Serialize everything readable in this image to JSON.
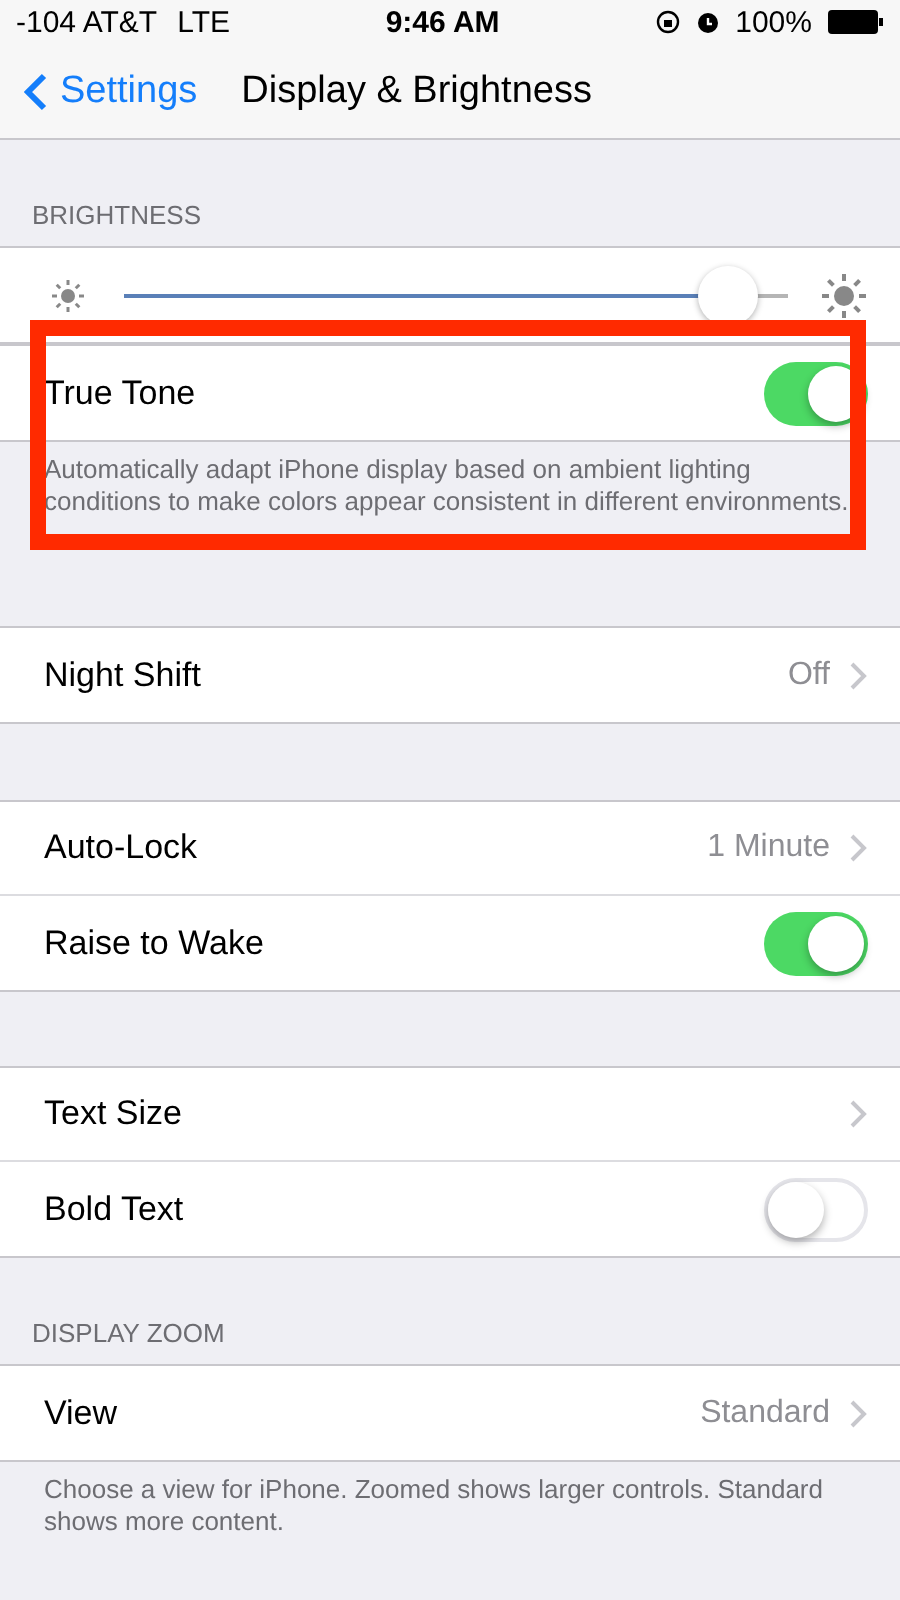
{
  "status_bar": {
    "carrier": "-104 AT&T",
    "network": "LTE",
    "time": "9:46 AM",
    "battery": "100%"
  },
  "nav": {
    "back": "Settings",
    "title": "Display & Brightness"
  },
  "sections": [
    {
      "header": "BRIGHTNESS",
      "highlighted": false,
      "rows": [
        {
          "kind": "slider",
          "level": 0.95
        }
      ]
    },
    {
      "highlighted": true,
      "rows": [
        {
          "kind": "toggle",
          "label": "True Tone",
          "on": true
        }
      ],
      "footer": "Automatically adapt iPhone display based on ambient lighting conditions to make colors appear consistent in different environments."
    },
    {
      "highlighted": false,
      "rows": [
        {
          "kind": "detail",
          "label": "Night Shift",
          "value": "Off"
        }
      ]
    },
    {
      "highlighted": false,
      "rows": [
        {
          "kind": "detail",
          "label": "Auto-Lock",
          "value": "1 Minute"
        },
        {
          "kind": "toggle",
          "label": "Raise to Wake",
          "on": true
        }
      ]
    },
    {
      "highlighted": false,
      "rows": [
        {
          "kind": "detail",
          "label": "Text Size"
        },
        {
          "kind": "toggle",
          "label": "Bold Text",
          "on": false
        }
      ]
    },
    {
      "header": "DISPLAY ZOOM",
      "highlighted": false,
      "rows": [
        {
          "kind": "detail",
          "label": "View",
          "value": "Standard"
        }
      ],
      "footer": "Choose a view for iPhone. Zoomed shows larger controls. Standard shows more content."
    }
  ]
}
